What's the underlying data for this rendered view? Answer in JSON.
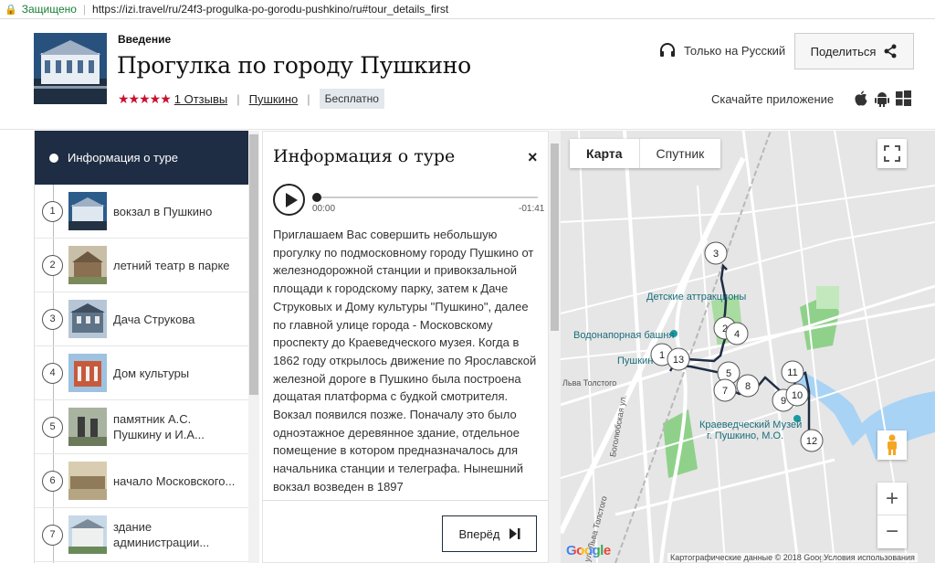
{
  "address_bar": {
    "secure_label": "Защищено",
    "url": "https://izi.travel/ru/24f3-progulka-po-gorodu-pushkino/ru#tour_details_first"
  },
  "header": {
    "kicker": "Введение",
    "title": "Прогулка по городу Пушкино",
    "rating_stars": "★★★★★",
    "reviews_link": "1 Отзывы",
    "city_link": "Пушкино",
    "price_badge": "Бесплатно",
    "language": "Только на Русский",
    "share_button": "Поделиться",
    "download_label": "Скачайте приложение"
  },
  "sidebar": {
    "active_item": "Информация о туре",
    "items": [
      {
        "num": "1",
        "label": "вокзал в Пушкино"
      },
      {
        "num": "2",
        "label": "летний театр в парке"
      },
      {
        "num": "3",
        "label": "Дача Струкова"
      },
      {
        "num": "4",
        "label": "Дом культуры"
      },
      {
        "num": "5",
        "label": "памятник А.С. Пушкину и И.А..."
      },
      {
        "num": "6",
        "label": "начало Московского..."
      },
      {
        "num": "7",
        "label": "здание администрации..."
      }
    ]
  },
  "panel": {
    "title": "Информация о туре",
    "close": "×",
    "time_current": "00:00",
    "time_remaining": "-01:41",
    "audio_progress": 0,
    "text": "Приглашаем Вас совершить небольшую прогулку по подмосковному городу Пушкино от железнодорожной станции и привокзальной площади к городскому парку, затем к  Даче Струковых и  Дому культуры \"Пушкино\",  далее по главной улице города - Московскому проспекту до Краеведческого музея. Когда в 1862 году открылось движение по Ярославской железной дороге в Пушкино была построена дощатая платформа с будкой смотрителя. Вокзал появился  позже. Поначалу это было  одноэтажное деревянное здание, отдельное помещение в котором предназначалось для начальника станции и телеграфа. Нынешний вокзал возведен в 1897",
    "next_button": "Вперёд"
  },
  "map": {
    "tab_map": "Карта",
    "tab_satellite": "Спутник",
    "zoom_in": "+",
    "zoom_out": "−",
    "logo": "Google",
    "copyright": "Картографические данные © 2018 Google",
    "terms": "Условия использования",
    "labels": {
      "attractions": "Детские аттракционы",
      "water_tower": "Водонапорная башня",
      "pushkino": "Пушкин",
      "tolstoy": "Льва Толстого",
      "museum_1": "Краеведческий Музей",
      "museum_2": "г. Пушкино, М.О.",
      "bogolyubovskaya": "Боголюбская ул.",
      "lev_tolstoy_street": "ул. Льва Толстого"
    },
    "markers": [
      "1",
      "2",
      "3",
      "4",
      "5",
      "7",
      "8",
      "9",
      "10",
      "11",
      "12",
      "13"
    ],
    "colors": {
      "route": "#1e2d43",
      "park": "#8fd18a",
      "water": "#a9d3f5"
    }
  },
  "colors": {
    "accent_dark": "#1e2d43",
    "stars": "#c8102e"
  }
}
